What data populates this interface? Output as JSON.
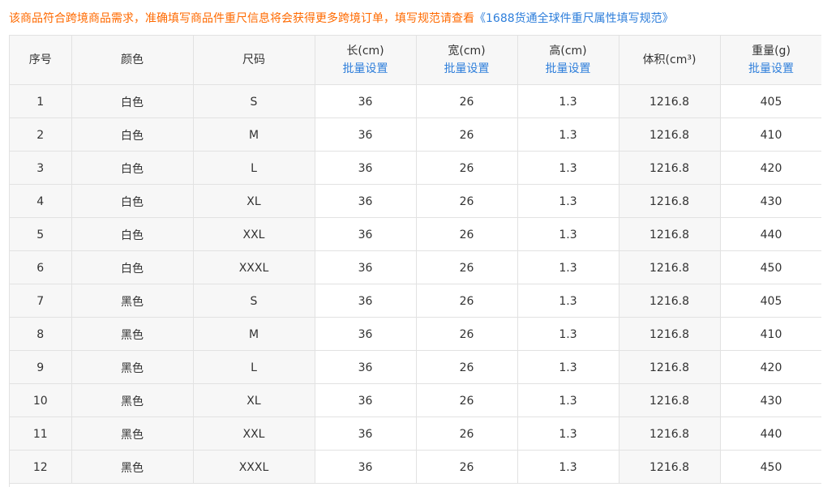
{
  "notice": {
    "text": "该商品符合跨境商品需求，准确填写商品件重尺信息将会获得更多跨境订单，填写规范请查看",
    "link": "《1688货通全球件重尺属性填写规范》"
  },
  "table": {
    "headers": {
      "index": "序号",
      "color": "颜色",
      "size": "尺码",
      "length": "长(cm)",
      "width": "宽(cm)",
      "height": "高(cm)",
      "volume": "体积(cm³)",
      "weight": "重量(g)"
    },
    "batch_label": "批量设置",
    "rows": [
      {
        "index": "1",
        "color": "白色",
        "size": "S",
        "length": "36",
        "width": "26",
        "height": "1.3",
        "volume": "1216.8",
        "weight": "405"
      },
      {
        "index": "2",
        "color": "白色",
        "size": "M",
        "length": "36",
        "width": "26",
        "height": "1.3",
        "volume": "1216.8",
        "weight": "410"
      },
      {
        "index": "3",
        "color": "白色",
        "size": "L",
        "length": "36",
        "width": "26",
        "height": "1.3",
        "volume": "1216.8",
        "weight": "420"
      },
      {
        "index": "4",
        "color": "白色",
        "size": "XL",
        "length": "36",
        "width": "26",
        "height": "1.3",
        "volume": "1216.8",
        "weight": "430"
      },
      {
        "index": "5",
        "color": "白色",
        "size": "XXL",
        "length": "36",
        "width": "26",
        "height": "1.3",
        "volume": "1216.8",
        "weight": "440"
      },
      {
        "index": "6",
        "color": "白色",
        "size": "XXXL",
        "length": "36",
        "width": "26",
        "height": "1.3",
        "volume": "1216.8",
        "weight": "450"
      },
      {
        "index": "7",
        "color": "黑色",
        "size": "S",
        "length": "36",
        "width": "26",
        "height": "1.3",
        "volume": "1216.8",
        "weight": "405"
      },
      {
        "index": "8",
        "color": "黑色",
        "size": "M",
        "length": "36",
        "width": "26",
        "height": "1.3",
        "volume": "1216.8",
        "weight": "410"
      },
      {
        "index": "9",
        "color": "黑色",
        "size": "L",
        "length": "36",
        "width": "26",
        "height": "1.3",
        "volume": "1216.8",
        "weight": "420"
      },
      {
        "index": "10",
        "color": "黑色",
        "size": "XL",
        "length": "36",
        "width": "26",
        "height": "1.3",
        "volume": "1216.8",
        "weight": "430"
      },
      {
        "index": "11",
        "color": "黑色",
        "size": "XXL",
        "length": "36",
        "width": "26",
        "height": "1.3",
        "volume": "1216.8",
        "weight": "440"
      },
      {
        "index": "12",
        "color": "黑色",
        "size": "XXXL",
        "length": "36",
        "width": "26",
        "height": "1.3",
        "volume": "1216.8",
        "weight": "450"
      }
    ]
  },
  "colors": {
    "warning": "#ff6a00",
    "link": "#2f7fdb",
    "header_bg": "#f7f7f7",
    "border": "#e2e2e2"
  }
}
